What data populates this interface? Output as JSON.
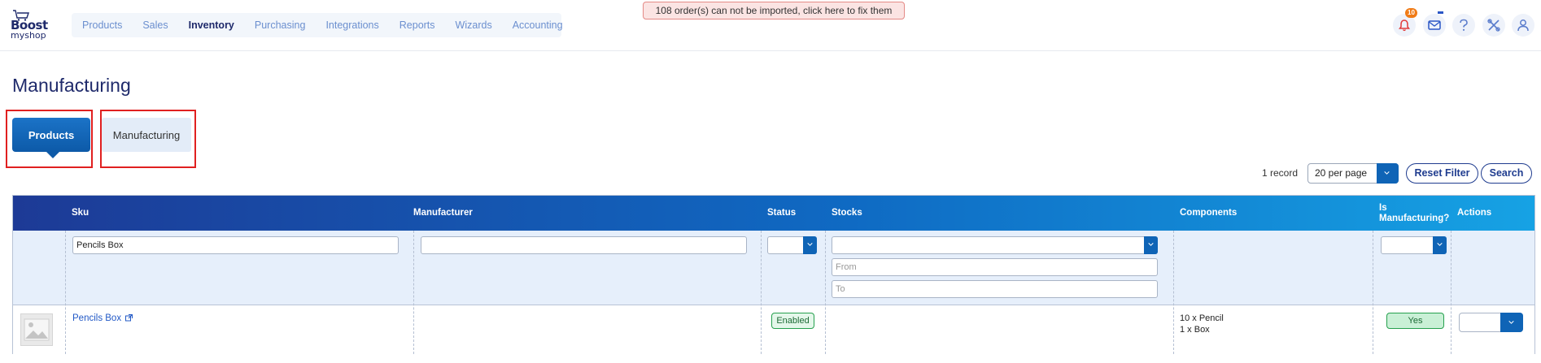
{
  "brand": {
    "logo_line1": "Boost",
    "logo_line2": "myshop"
  },
  "nav": {
    "items": [
      "Products",
      "Sales",
      "Inventory",
      "Purchasing",
      "Integrations",
      "Reports",
      "Wizards",
      "Accounting"
    ],
    "active": "Inventory"
  },
  "alert": {
    "text": "108 order(s) can not be imported, click here to fix them"
  },
  "header_icons": {
    "notifications_count": "10",
    "icons": [
      "bell-icon",
      "mail-icon",
      "help-icon",
      "tools-icon",
      "user-icon"
    ],
    "accent_color": "#2a56c6",
    "badge_color": "#f07b16"
  },
  "page": {
    "title": "Manufacturing"
  },
  "tabs": [
    {
      "label": "Products",
      "active": true
    },
    {
      "label": "Manufacturing",
      "active": false
    }
  ],
  "toolbar": {
    "record_count": "1 record",
    "per_page": "20 per page",
    "reset_filter": "Reset Filter",
    "search": "Search"
  },
  "grid": {
    "columns": [
      "",
      "Sku",
      "Manufacturer",
      "Status",
      "Stocks",
      "Components",
      "Is Manufacturing?",
      "Actions"
    ],
    "filters": {
      "sku": "Pencils Box",
      "manufacturer": "",
      "stocks_from_placeholder": "From",
      "stocks_to_placeholder": "To"
    },
    "rows": [
      {
        "sku": "Pencils Box",
        "manufacturer": "",
        "status": "Enabled",
        "components": [
          "10 x Pencil",
          "1 x Box"
        ],
        "is_manufacturing": "Yes"
      }
    ]
  },
  "colors": {
    "header_gradient": [
      "#1d3a96",
      "#0f6ac3",
      "#16a2e4"
    ],
    "primary": "#0f64b6",
    "title": "#1f2a6b",
    "success": "#26a04e",
    "highlight": "#e02020"
  }
}
